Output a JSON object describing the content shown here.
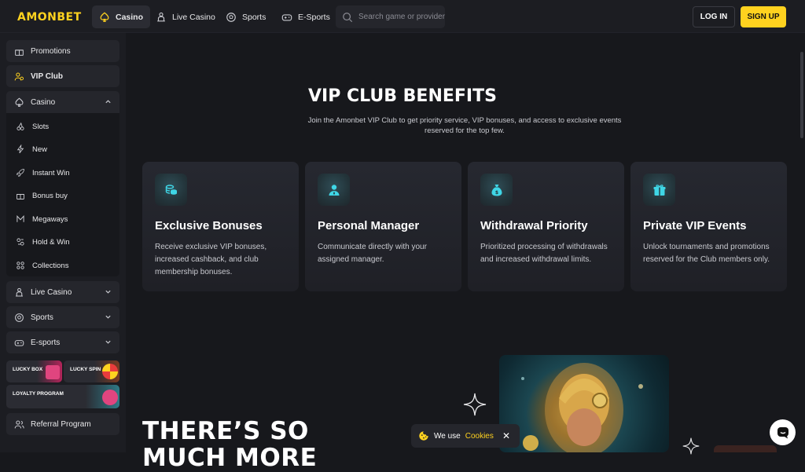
{
  "header": {
    "logo": "AMONBET",
    "tabs": [
      {
        "label": "Casino",
        "icon": "casino-icon"
      },
      {
        "label": "Live Casino",
        "icon": "dealer-icon"
      },
      {
        "label": "Sports",
        "icon": "ball-icon"
      },
      {
        "label": "E-Sports",
        "icon": "gamepad-icon"
      }
    ],
    "search_placeholder": "Search game or provider",
    "login_label": "LOG IN",
    "signup_label": "SIGN UP"
  },
  "sidebar": {
    "promotions": "Promotions",
    "vip_club": "VIP Club",
    "casino": "Casino",
    "casino_sub": [
      "Slots",
      "New",
      "Instant Win",
      "Bonus buy",
      "Megaways",
      "Hold & Win",
      "Collections"
    ],
    "live_casino": "Live Casino",
    "sports": "Sports",
    "esports": "E-sports",
    "lucky_box": "LUCKY BOX",
    "lucky_spin": "LUCKY SPIN",
    "loyalty": "LOYALTY PROGRAM",
    "referral": "Referral Program"
  },
  "main": {
    "title": "VIP CLUB BENEFITS",
    "subtitle": "Join the Amonbet VIP Club to get priority service, VIP bonuses, and access to exclusive events reserved for the top few.",
    "cards": [
      {
        "title": "Exclusive Bonuses",
        "text": "Receive exclusive VIP bonuses, increased cashback, and club membership bonuses.",
        "icon": "coins-icon"
      },
      {
        "title": "Personal Manager",
        "text": "Communicate directly with your assigned manager.",
        "icon": "manager-icon"
      },
      {
        "title": "Withdrawal Priority",
        "text": "Prioritized processing of withdrawals and increased withdrawal limits.",
        "icon": "money-bag-icon"
      },
      {
        "title": "Private VIP Events",
        "text": "Unlock tournaments and promotions reserved for the Club members only.",
        "icon": "gift-icon"
      }
    ],
    "promo_heading_line1": "THERE’S SO",
    "promo_heading_line2": "MUCH MORE"
  },
  "cookie": {
    "text": "We use",
    "link": "Cookies",
    "close": "✕"
  },
  "colors": {
    "accent": "#ffd21f",
    "background": "#17181c",
    "panel": "#25262c",
    "icon_teal": "#3fd6e6"
  }
}
